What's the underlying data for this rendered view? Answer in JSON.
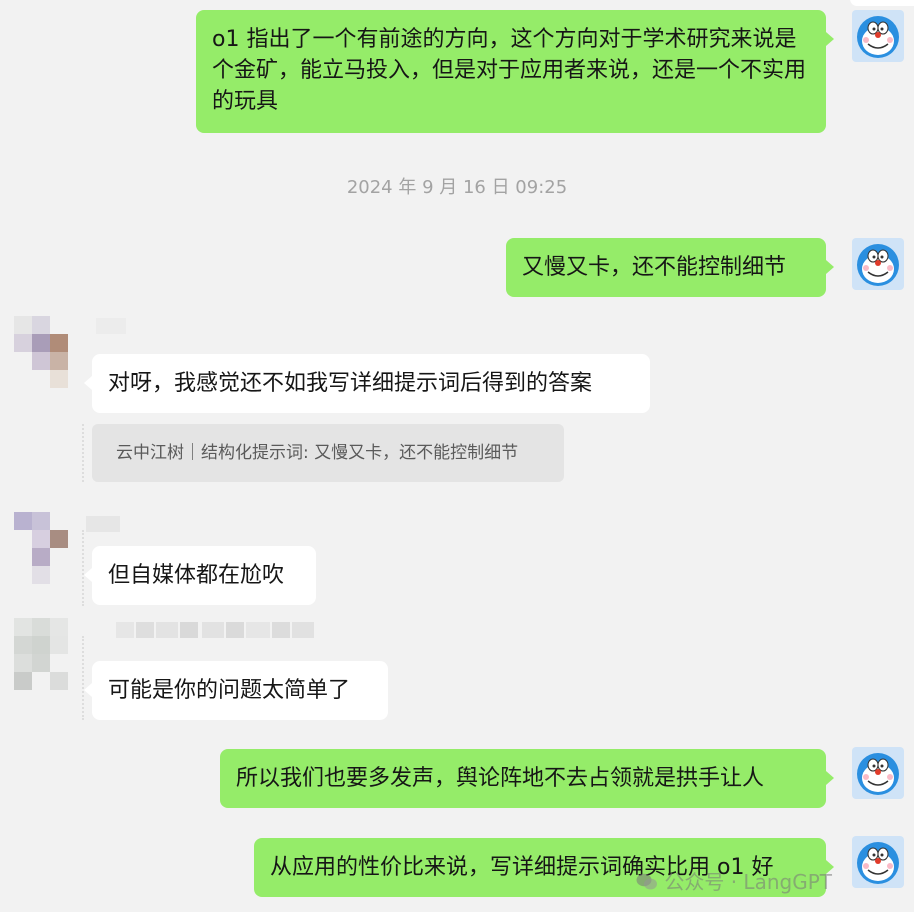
{
  "messages": {
    "m1": "o1 指出了一个有前途的方向，这个方向对于学术研究来说是个金矿，能立马投入，但是对于应用者来说，还是一个不实用的玩具",
    "timestamp": "2024 年 9 月 16 日 09:25",
    "m2": "又慢又卡，还不能控制细节",
    "m3": "对呀，我感觉还不如我写详细提示词后得到的答案",
    "quote": "云中江树｜结构化提示词: 又慢又卡，还不能控制细节",
    "m4": "但自媒体都在尬吹",
    "m5": "可能是你的问题太简单了",
    "m6": "所以我们也要多发声，舆论阵地不去占领就是拱手让人",
    "m7": "从应用的性价比来说，写详细提示词确实比用 o1 好"
  },
  "watermark": "公众号 · LangGPT",
  "colors": {
    "outgoing_bubble": "#95ec69",
    "incoming_bubble": "#ffffff",
    "background": "#f2f2f2"
  },
  "icons": {
    "self_avatar": "doraemon-avatar-icon",
    "other_avatar": "blurred-avatar",
    "watermark_icon": "wechat-icon"
  }
}
